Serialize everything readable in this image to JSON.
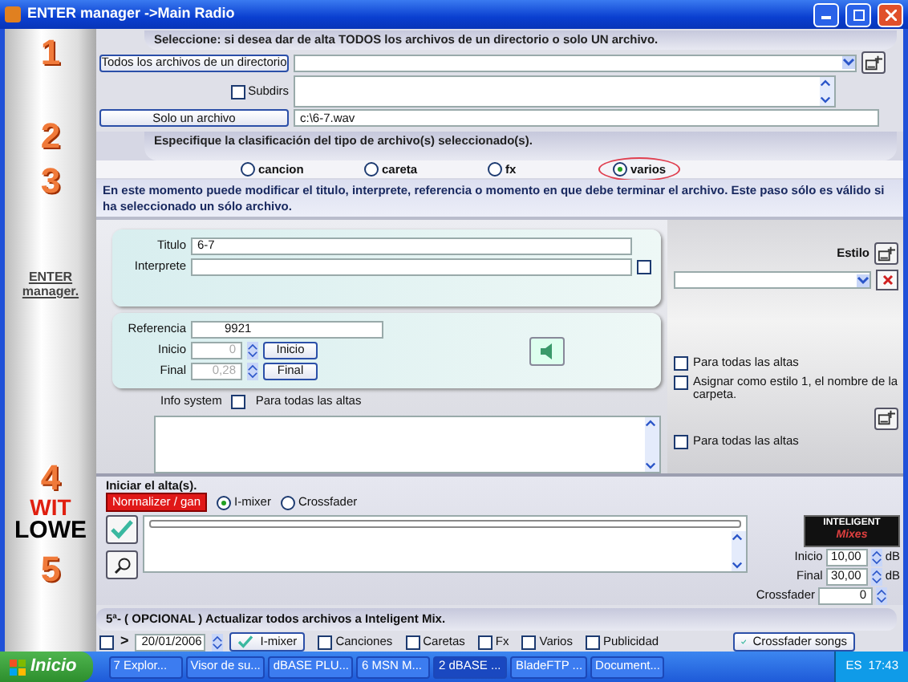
{
  "window": {
    "title": "ENTER manager   ->Main Radio"
  },
  "sidebar": {
    "steps": [
      "1",
      "2",
      "3",
      "4",
      "5"
    ],
    "brand": "ENTER manager.",
    "badge_top": "WIT",
    "badge_bottom": "LOWE"
  },
  "step1": {
    "header": "Seleccione: si desea dar de alta TODOS los archivos de un directorio o solo UN archivo.",
    "all_button": "Todos los archivos de un directorio",
    "subdirs": {
      "label": "Subdirs",
      "checked": false
    },
    "single_button": "Solo un archivo",
    "file_path": "c:\\6-7.wav"
  },
  "step2": {
    "header": "Especifique la clasificación del tipo de archivo(s) seleccionado(s).",
    "types": [
      {
        "label": "cancion",
        "selected": false
      },
      {
        "label": "careta",
        "selected": false
      },
      {
        "label": "fx",
        "selected": false
      },
      {
        "label": "varios",
        "selected": true
      }
    ]
  },
  "step3": {
    "header": "En este momento puede modificar el titulo, interprete, referencia o momento en que debe terminar el archivo. Este paso sólo es válido si ha seleccionado un sólo archivo.",
    "titulo": {
      "label": "Titulo",
      "value": "6-7"
    },
    "interprete": {
      "label": "Interprete",
      "checked": false
    },
    "referencia": {
      "label": "Referencia",
      "value": "9921"
    },
    "inicio": {
      "label": "Inicio",
      "value": "0",
      "disabled": true,
      "button": "Inicio"
    },
    "final": {
      "label": "Final",
      "value": "0,28",
      "disabled": true,
      "button": "Final"
    },
    "info_label": "Info system",
    "info_all": {
      "label": "Para todas las altas",
      "checked": false
    },
    "estilo_label": "Estilo",
    "options": [
      {
        "label": "Para todas las altas",
        "checked": false
      },
      {
        "label": "Asignar como estilo 1, el nombre de la carpeta.",
        "checked": false
      }
    ],
    "style_all": {
      "label": "Para todas las altas",
      "checked": false
    }
  },
  "step4": {
    "header": "Iniciar el alta(s).",
    "normalizer": "Normalizer / gan",
    "progress": {
      "level": 0
    },
    "modes": [
      {
        "label": "I-mixer",
        "selected": true
      },
      {
        "label": "Crossfader",
        "selected": false
      }
    ],
    "logo_top": "INTELIGENT",
    "logo_bottom": "Mixes",
    "levels": [
      {
        "label": "Inicio",
        "value": "10,00",
        "unit": "dB"
      },
      {
        "label": "Final",
        "value": "30,00",
        "unit": "dB"
      }
    ],
    "crossfader": {
      "label": "Crossfader",
      "value": "0"
    }
  },
  "step5": {
    "header": "5ª- ( OPCIONAL ) Actualizar todos archivos a Inteligent Mix.",
    "date_check": {
      "checked": false
    },
    "compare": ">",
    "date": "20/01/2006",
    "imixer_button": "I-mixer",
    "filters": [
      {
        "label": "Canciones",
        "checked": false
      },
      {
        "label": "Caretas",
        "checked": false
      },
      {
        "label": "Fx",
        "checked": false
      },
      {
        "label": "Varios",
        "checked": false
      },
      {
        "label": "Publicidad",
        "checked": false
      }
    ],
    "crossfader_button": "Crossfader songs"
  },
  "taskbar": {
    "start": "Inicio",
    "items": [
      {
        "label": "7 Explor...",
        "selected": false
      },
      {
        "label": "Visor de su...",
        "selected": false
      },
      {
        "label": "dBASE PLU...",
        "selected": false
      },
      {
        "label": "6 MSN M...",
        "selected": false
      },
      {
        "label": "2 dBASE ...",
        "selected": true
      },
      {
        "label": "BladeFTP ...",
        "selected": false
      },
      {
        "label": "Document...",
        "selected": false
      }
    ],
    "language": "ES",
    "clock": "17:43"
  }
}
